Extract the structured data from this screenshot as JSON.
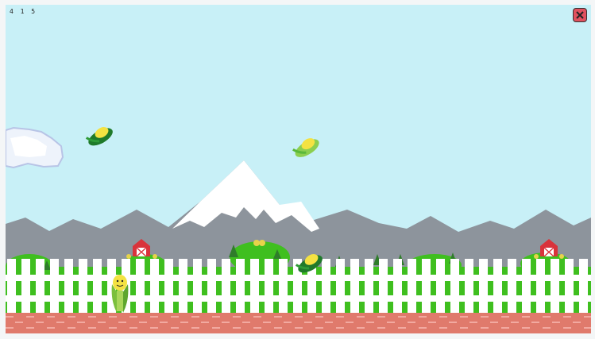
{
  "hud": {
    "score": "4 1 5",
    "close_icon": "close-x-icon"
  },
  "colors": {
    "sky": "#c8f0f7",
    "mountain": "#8d949c",
    "snow": "#ffffff",
    "grass": "#3fbf1f",
    "fence": "#ffffff",
    "brick": "#e07a6c",
    "barn": "#d9333b",
    "close_button": "#e0515e"
  },
  "sprites": {
    "falling_corn": [
      "corn-cob-icon",
      "corn-cob-icon",
      "corn-cob-icon"
    ],
    "player": "corn-character-icon",
    "cloud": "cloud-icon",
    "barns": [
      "barn-icon",
      "barn-icon"
    ]
  }
}
